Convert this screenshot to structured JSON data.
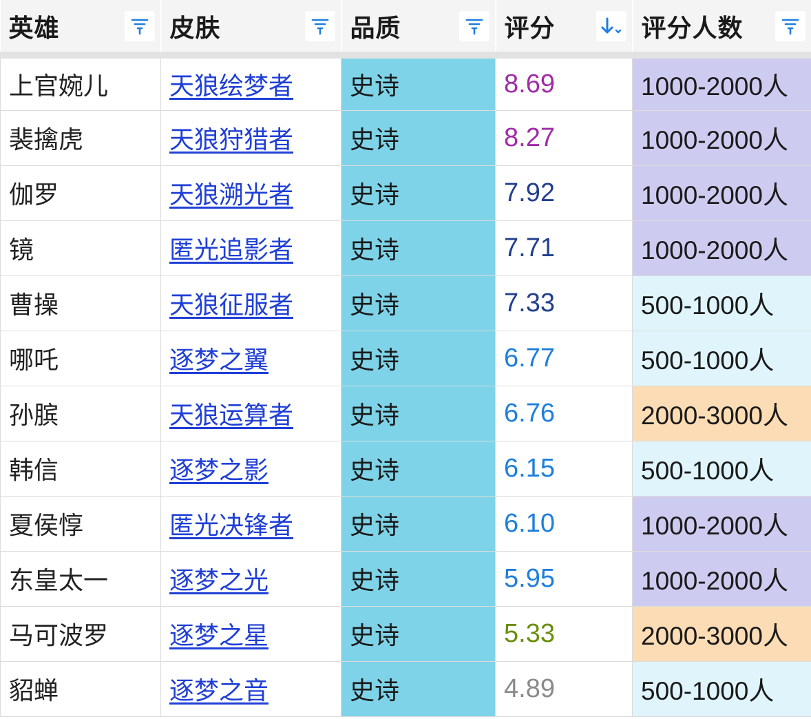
{
  "columns": [
    {
      "label": "英雄",
      "icon": "filter-icon"
    },
    {
      "label": "皮肤",
      "icon": "filter-icon"
    },
    {
      "label": "品质",
      "icon": "filter-icon"
    },
    {
      "label": "评分",
      "icon": "sort-descending-icon"
    },
    {
      "label": "评分人数",
      "icon": "filter-icon"
    }
  ],
  "colors": {
    "header_bg": "#f4f4f4",
    "icon_blue": "#1f7ee0",
    "link": "#1f3fd6",
    "quality_bg": "#7ed3e8",
    "count_1000_2000": "#cdcbf0",
    "count_500_1000": "#dff4fb",
    "count_2000_3000": "#fbdcb4",
    "score_purple": "#a12ba8",
    "score_darkblue": "#23408f",
    "score_blue": "#1e7fdc",
    "score_olive": "#6a8e0c",
    "score_gray": "#8a8a8a"
  },
  "rows": [
    {
      "hero": "上官婉儿",
      "skin": "天狼绘梦者",
      "quality": "史诗",
      "score": "8.69",
      "score_color": "#a12ba8",
      "count": "1000-2000人",
      "count_bg": "#cdcbf0"
    },
    {
      "hero": "裴擒虎",
      "skin": "天狼狩猎者",
      "quality": "史诗",
      "score": "8.27",
      "score_color": "#a12ba8",
      "count": "1000-2000人",
      "count_bg": "#cdcbf0"
    },
    {
      "hero": "伽罗",
      "skin": "天狼溯光者",
      "quality": "史诗",
      "score": "7.92",
      "score_color": "#23408f",
      "count": "1000-2000人",
      "count_bg": "#cdcbf0"
    },
    {
      "hero": "镜",
      "skin": "匿光追影者",
      "quality": "史诗",
      "score": "7.71",
      "score_color": "#23408f",
      "count": "1000-2000人",
      "count_bg": "#cdcbf0"
    },
    {
      "hero": "曹操",
      "skin": "天狼征服者",
      "quality": "史诗",
      "score": "7.33",
      "score_color": "#23408f",
      "count": "500-1000人",
      "count_bg": "#dff4fb"
    },
    {
      "hero": "哪吒",
      "skin": "逐梦之翼",
      "quality": "史诗",
      "score": "6.77",
      "score_color": "#1e7fdc",
      "count": "500-1000人",
      "count_bg": "#dff4fb"
    },
    {
      "hero": "孙膑",
      "skin": "天狼运算者",
      "quality": "史诗",
      "score": "6.76",
      "score_color": "#1e7fdc",
      "count": "2000-3000人",
      "count_bg": "#fbdcb4"
    },
    {
      "hero": "韩信",
      "skin": "逐梦之影",
      "quality": "史诗",
      "score": "6.15",
      "score_color": "#1e7fdc",
      "count": "500-1000人",
      "count_bg": "#dff4fb"
    },
    {
      "hero": "夏侯惇",
      "skin": "匿光决锋者",
      "quality": "史诗",
      "score": "6.10",
      "score_color": "#1e7fdc",
      "count": "1000-2000人",
      "count_bg": "#cdcbf0"
    },
    {
      "hero": "东皇太一",
      "skin": "逐梦之光",
      "quality": "史诗",
      "score": "5.95",
      "score_color": "#1e7fdc",
      "count": "1000-2000人",
      "count_bg": "#cdcbf0"
    },
    {
      "hero": "马可波罗",
      "skin": "逐梦之星",
      "quality": "史诗",
      "score": "5.33",
      "score_color": "#6a8e0c",
      "count": "2000-3000人",
      "count_bg": "#fbdcb4"
    },
    {
      "hero": "貂蝉",
      "skin": "逐梦之音",
      "quality": "史诗",
      "score": "4.89",
      "score_color": "#8a8a8a",
      "count": "500-1000人",
      "count_bg": "#dff4fb"
    }
  ]
}
